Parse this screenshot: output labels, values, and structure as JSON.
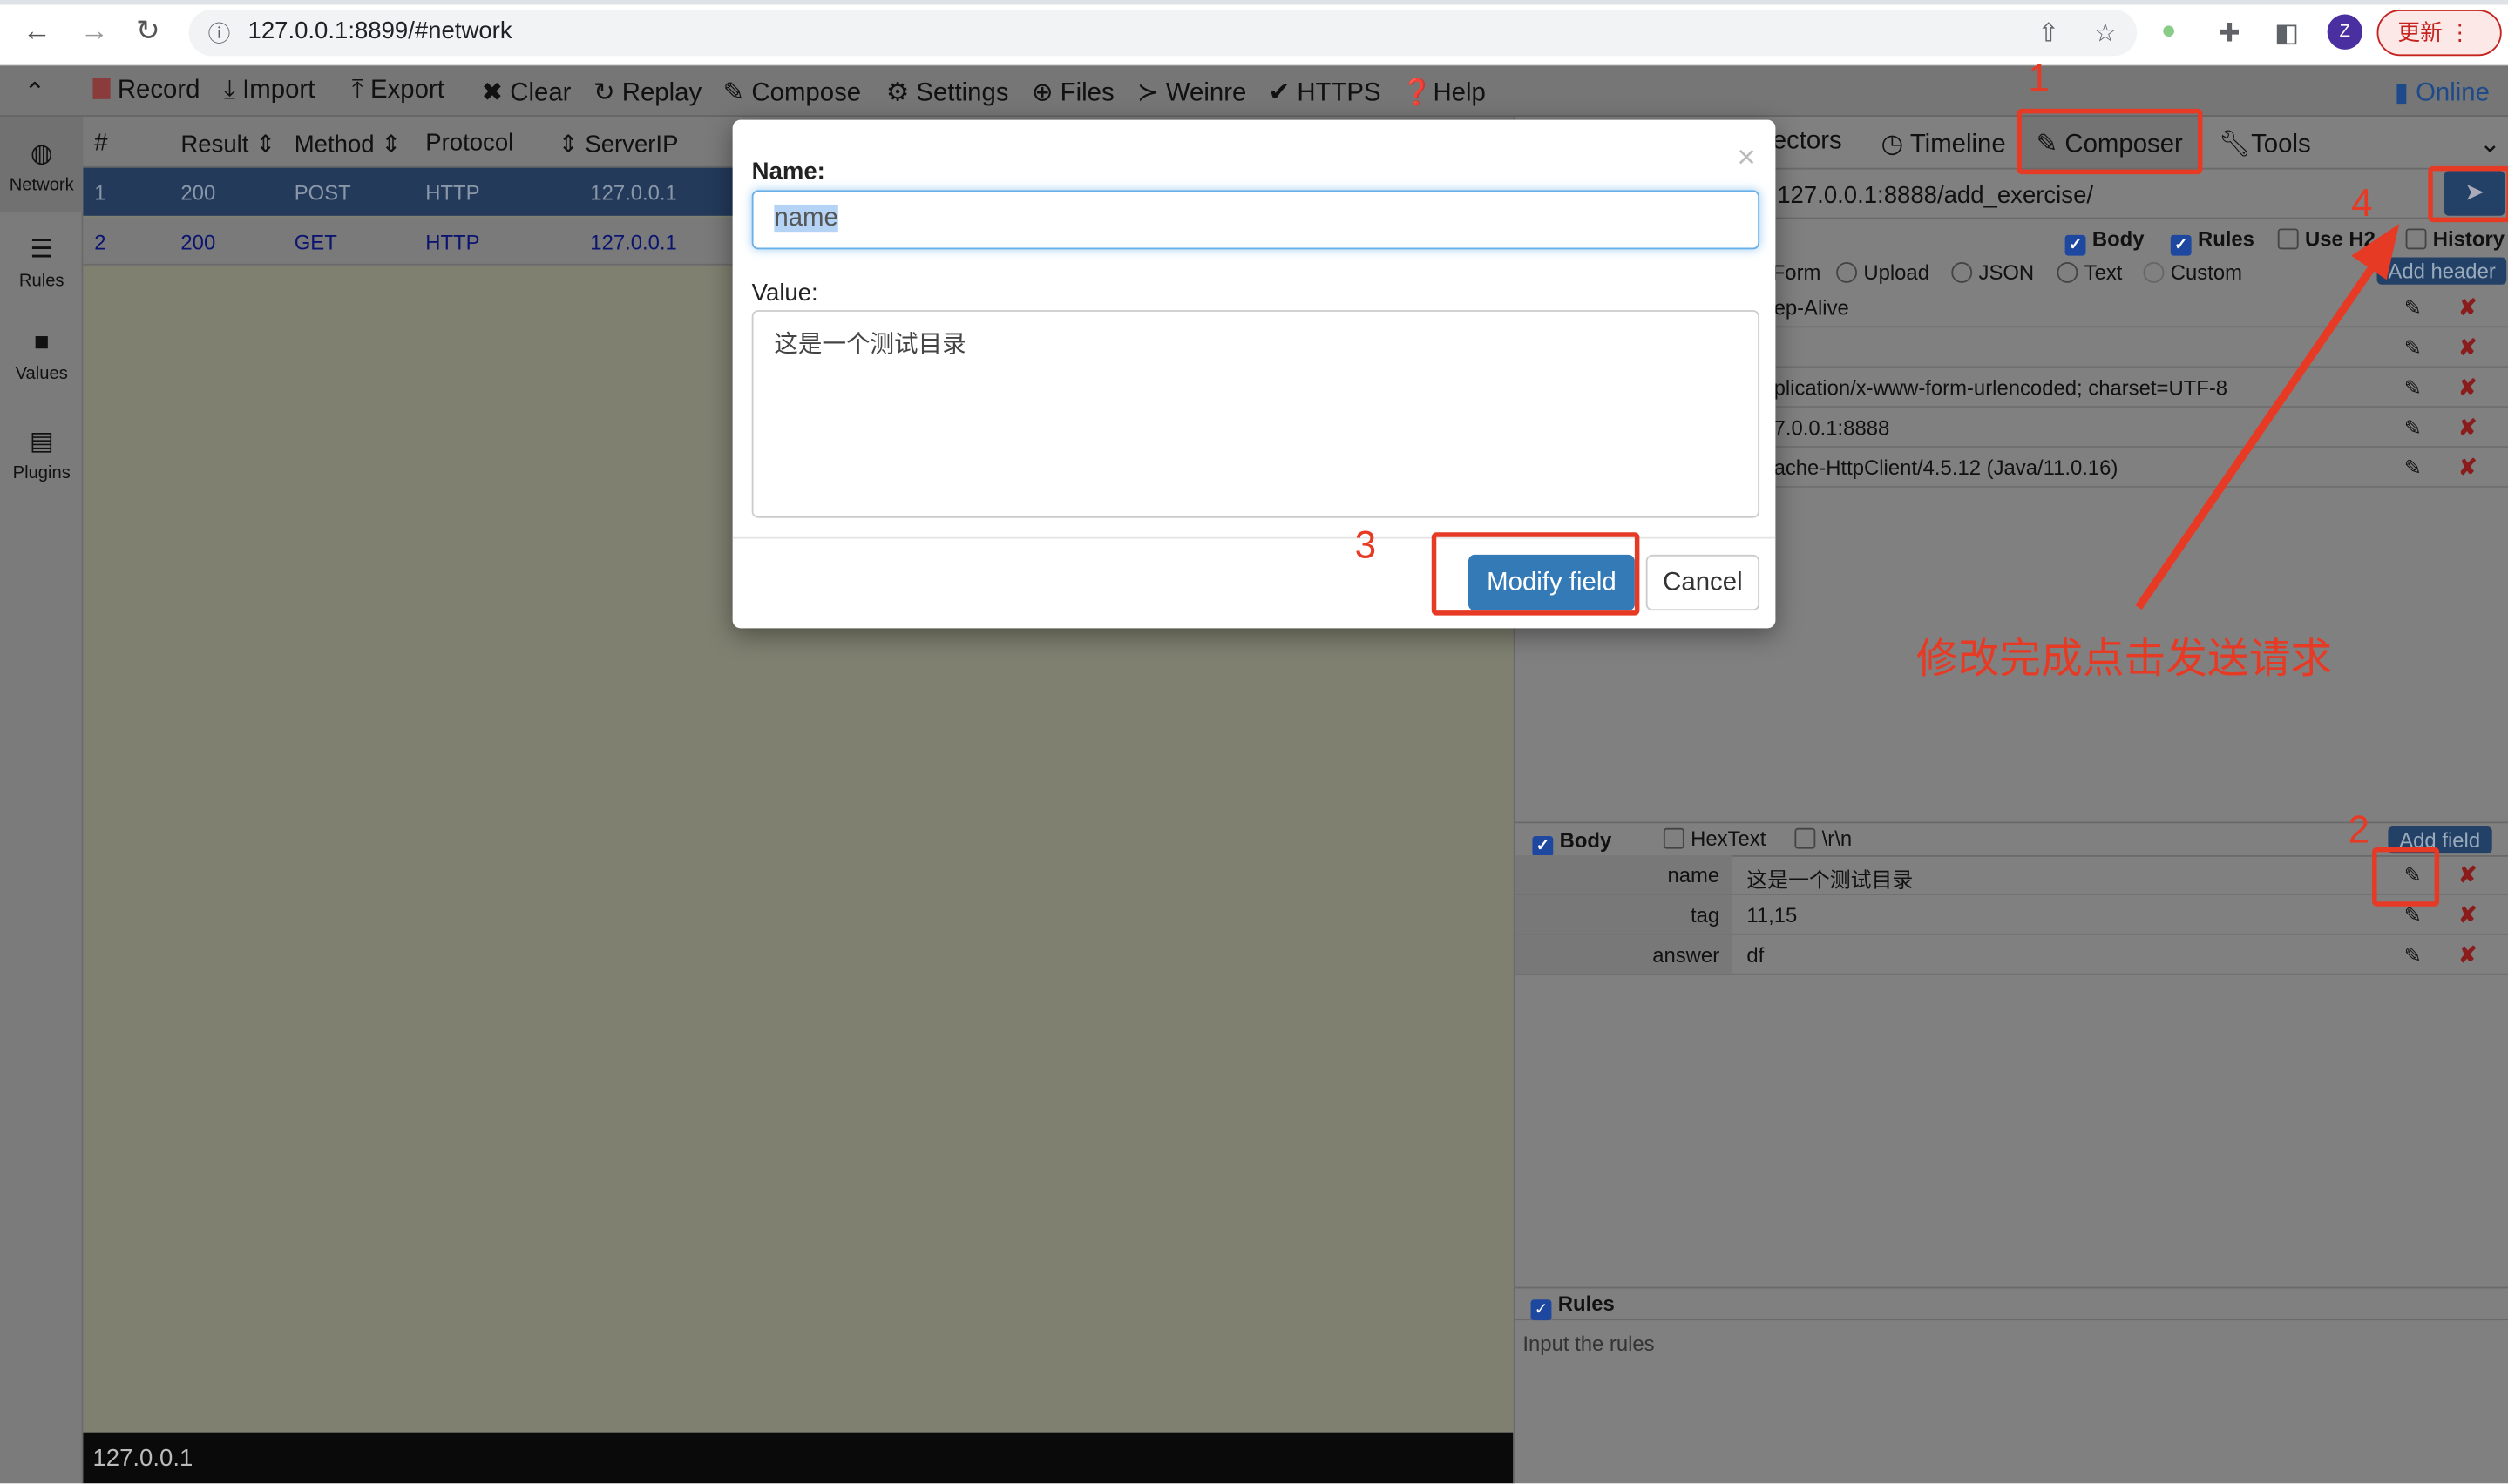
{
  "browser": {
    "url": "127.0.0.1:8899/#network",
    "update_label": "更新",
    "avatar_letter": "Z"
  },
  "toolbar": {
    "items": [
      "Record",
      "Import",
      "Export",
      "Clear",
      "Replay",
      "Compose",
      "Settings",
      "Files",
      "Weinre",
      "HTTPS",
      "Help"
    ],
    "online": "Online"
  },
  "sidebar": {
    "items": [
      "Network",
      "Rules",
      "Values",
      "Plugins"
    ]
  },
  "table": {
    "columns": [
      "#",
      "Result",
      "Method",
      "Protocol",
      "ServerIP"
    ],
    "rows": [
      [
        "1",
        "200",
        "POST",
        "HTTP",
        "127.0.0.1"
      ],
      [
        "2",
        "200",
        "GET",
        "HTTP",
        "127.0.0.1"
      ]
    ]
  },
  "status_bar": "127.0.0.1",
  "right": {
    "tabs": [
      "ectors",
      "Timeline",
      "Composer",
      "Tools"
    ],
    "url": "127.0.0.1:8888/add_exercise/",
    "options": [
      "Body",
      "Rules",
      "Use H2",
      "History"
    ],
    "types": [
      "Form",
      "Upload",
      "JSON",
      "Text",
      "Custom"
    ],
    "add_header": "Add header",
    "headers": [
      "ep-Alive",
      "",
      "plication/x-www-form-urlencoded; charset=UTF-8",
      "7.0.0.1:8888",
      "ache-HttpClient/4.5.12 (Java/11.0.16)"
    ],
    "body_label": "Body",
    "hextext": "HexText",
    "crlf": "\\r\\n",
    "add_field": "Add field",
    "fields": [
      {
        "k": "name",
        "v": "这是一个测试目录"
      },
      {
        "k": "tag",
        "v": "11,15"
      },
      {
        "k": "answer",
        "v": "df"
      }
    ],
    "rules_label": "Rules",
    "rules_placeholder": "Input the rules"
  },
  "modal": {
    "name_label": "Name:",
    "name_value": "name",
    "value_label": "Value:",
    "value_text": "这是一个测试目录",
    "modify": "Modify field",
    "cancel": "Cancel",
    "close": "×"
  },
  "annotations": {
    "n1": "1",
    "n2": "2",
    "n3": "3",
    "n4": "4",
    "note": "修改完成点击发送请求",
    "color": "#e63a25"
  }
}
